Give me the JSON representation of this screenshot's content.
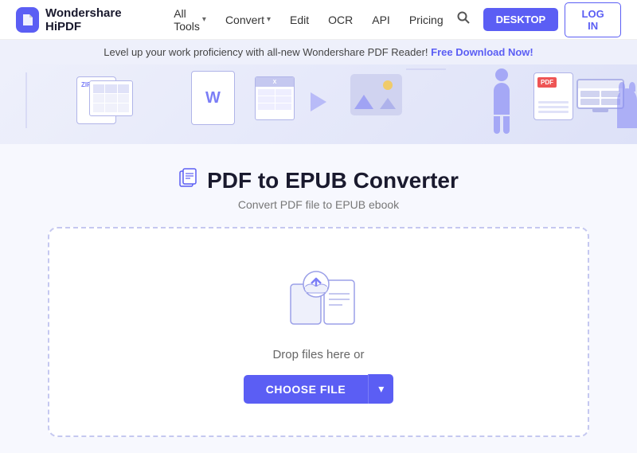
{
  "navbar": {
    "logo_text": "Wondershare HiPDF",
    "nav_items": [
      {
        "label": "All Tools",
        "has_caret": true
      },
      {
        "label": "Convert",
        "has_caret": true
      },
      {
        "label": "Edit",
        "has_caret": false
      },
      {
        "label": "OCR",
        "has_caret": false
      },
      {
        "label": "API",
        "has_caret": false
      },
      {
        "label": "Pricing",
        "has_caret": false
      }
    ],
    "desktop_btn": "DESKTOP",
    "login_btn": "LOG IN"
  },
  "banner": {
    "text": "Level up your work proficiency with all-new Wondershare PDF Reader!",
    "link_text": "Free Download Now!"
  },
  "page": {
    "title": "PDF to EPUB Converter",
    "subtitle": "Convert PDF file to EPUB ebook",
    "drop_text": "Drop files here or",
    "choose_file_btn": "CHOOSE FILE"
  }
}
